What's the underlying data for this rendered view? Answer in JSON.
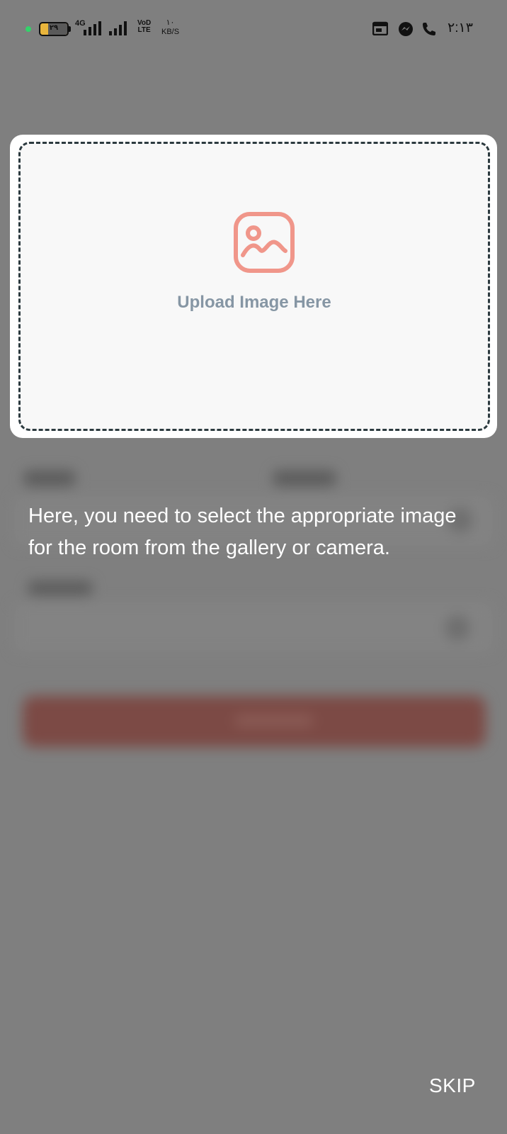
{
  "status_bar": {
    "battery_text": "۲۹",
    "battery_level": 0.29,
    "network_type": "4G",
    "volte_top": "VoD",
    "volte_bottom": "LTE",
    "speed_value": "۱۰",
    "speed_unit": "KB/S",
    "time": "۲:۱۳",
    "icons": [
      "battery-icon",
      "signal-icon",
      "signal-icon",
      "volte-icon",
      "calendar-icon",
      "messenger-icon",
      "call-icon"
    ]
  },
  "upload": {
    "label": "Upload Image Here",
    "icon": "image-icon",
    "icon_color": "#f0968a",
    "border_color": "#2c3a3f"
  },
  "coach": {
    "message": "Here, you need to select the appropriate image for the room from the gallery or camera.",
    "skip_label": "SKIP"
  },
  "colors": {
    "overlay": "#7f7f7f",
    "upload_label": "#8696a4"
  }
}
